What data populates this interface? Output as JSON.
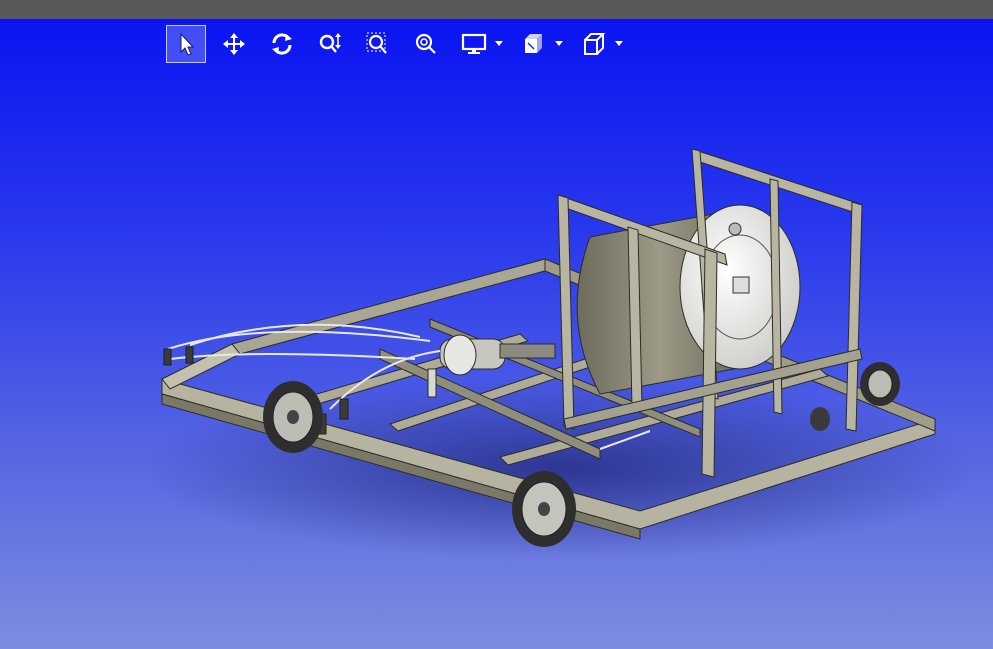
{
  "window": {
    "title": ""
  },
  "toolbar": {
    "tools": [
      {
        "id": "select",
        "icon": "pointer-icon",
        "active": true
      },
      {
        "id": "pan",
        "icon": "pan-move-icon",
        "active": false
      },
      {
        "id": "rotate",
        "icon": "rotate-icon",
        "active": false
      },
      {
        "id": "zoom",
        "icon": "zoom-updown-icon",
        "active": false
      },
      {
        "id": "zoom-window",
        "icon": "zoom-window-icon",
        "active": false
      },
      {
        "id": "zoom-fit",
        "icon": "zoom-fit-icon",
        "active": false
      },
      {
        "id": "display-mode",
        "icon": "monitor-icon",
        "dropdown": true
      },
      {
        "id": "render-style",
        "icon": "render-style-icon",
        "dropdown": true
      },
      {
        "id": "view-orientation",
        "icon": "cube-view-icon",
        "dropdown": true
      }
    ]
  },
  "viewport": {
    "background_top": "#0a14f2",
    "background_bottom": "#7e8ce0",
    "model": "wheeled-frame-assembly"
  },
  "colors": {
    "frame_face": "#b4b29e",
    "frame_dark": "#6e6c5c",
    "tank": "#8a8874",
    "tank_end": "#e8e8e4",
    "tire": "#2c2c2c",
    "icon": "#ffffff"
  }
}
